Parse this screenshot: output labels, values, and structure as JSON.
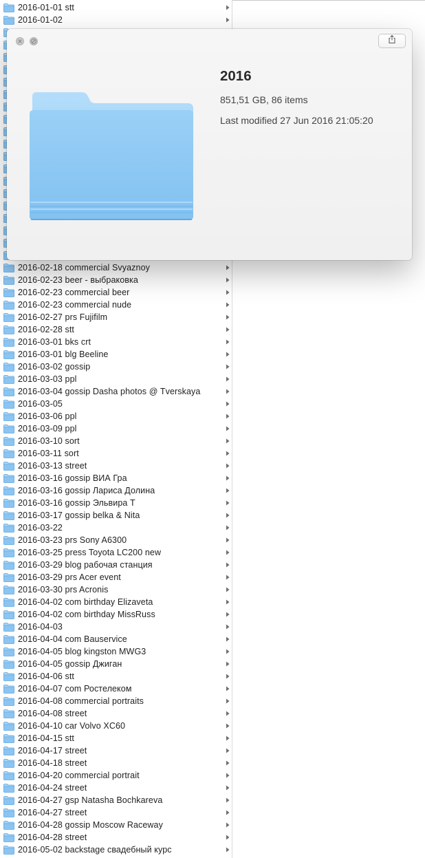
{
  "colors": {
    "folder_light": "#a9d6f7",
    "folder_body": "#8cc5f2",
    "folder_dark": "#5aa3dc",
    "text": "#222222",
    "chevron": "#6e6e6e"
  },
  "icons": {
    "row_icon": "folder-icon",
    "row_disclosure": "chevron-right-icon",
    "panel_close": "close-icon",
    "panel_fullscreen": "fullscreen-icon",
    "panel_share": "share-icon",
    "preview": "folder-icon"
  },
  "finder": {
    "items": [
      {
        "label": "2016-01-01 stt"
      },
      {
        "label": "2016-01-02"
      },
      {
        "label": ""
      },
      {
        "label": ""
      },
      {
        "label": ""
      },
      {
        "label": ""
      },
      {
        "label": ""
      },
      {
        "label": ""
      },
      {
        "label": ""
      },
      {
        "label": ""
      },
      {
        "label": ""
      },
      {
        "label": ""
      },
      {
        "label": ""
      },
      {
        "label": ""
      },
      {
        "label": ""
      },
      {
        "label": ""
      },
      {
        "label": ""
      },
      {
        "label": ""
      },
      {
        "label": ""
      },
      {
        "label": ""
      },
      {
        "label": ""
      },
      {
        "label": "2016-02-18 commercial Svyaznoy"
      },
      {
        "label": "2016-02-23 beer - выбраковка"
      },
      {
        "label": "2016-02-23 commercial beer"
      },
      {
        "label": "2016-02-23 commercial nude"
      },
      {
        "label": "2016-02-27 prs Fujifilm"
      },
      {
        "label": "2016-02-28 stt"
      },
      {
        "label": "2016-03-01 bks crt"
      },
      {
        "label": "2016-03-01 blg Beeline"
      },
      {
        "label": "2016-03-02 gossip"
      },
      {
        "label": "2016-03-03 ppl"
      },
      {
        "label": "2016-03-04 gossip Dasha photos @ Tverskaya"
      },
      {
        "label": "2016-03-05"
      },
      {
        "label": "2016-03-06 ppl"
      },
      {
        "label": "2016-03-09 ppl"
      },
      {
        "label": "2016-03-10 sort"
      },
      {
        "label": "2016-03-11 sort"
      },
      {
        "label": "2016-03-13 street"
      },
      {
        "label": "2016-03-16 gossip ВИА Гра"
      },
      {
        "label": "2016-03-16 gossip Лариса Долина"
      },
      {
        "label": "2016-03-16 gossip Эльвира Т"
      },
      {
        "label": "2016-03-17 gossip belka & Nita"
      },
      {
        "label": "2016-03-22"
      },
      {
        "label": "2016-03-23 prs Sony A6300"
      },
      {
        "label": "2016-03-25 press Toyota LC200 new"
      },
      {
        "label": "2016-03-29 blog рабочая станция"
      },
      {
        "label": "2016-03-29 prs Acer event"
      },
      {
        "label": "2016-03-30 prs Acronis"
      },
      {
        "label": "2016-04-02 com birthday Elizaveta"
      },
      {
        "label": "2016-04-02 com birthday MissRuss"
      },
      {
        "label": "2016-04-03"
      },
      {
        "label": "2016-04-04 com Bauservice"
      },
      {
        "label": "2016-04-05 blog kingston MWG3"
      },
      {
        "label": "2016-04-05 gossip Джиган"
      },
      {
        "label": "2016-04-06 stt"
      },
      {
        "label": "2016-04-07 com Ростелеком"
      },
      {
        "label": "2016-04-08 commercial portraits"
      },
      {
        "label": "2016-04-08 street"
      },
      {
        "label": "2016-04-10 car Volvo XC60"
      },
      {
        "label": "2016-04-15 stt"
      },
      {
        "label": "2016-04-17 street"
      },
      {
        "label": "2016-04-18 street"
      },
      {
        "label": "2016-04-20 commercial portrait"
      },
      {
        "label": "2016-04-24 street"
      },
      {
        "label": "2016-04-27 gsp Natasha Bochkareva"
      },
      {
        "label": "2016-04-27 street"
      },
      {
        "label": "2016-04-28 gossip Moscow Raceway"
      },
      {
        "label": "2016-04-28 street"
      },
      {
        "label": "2016-05-02 backstage свадебный курс"
      }
    ]
  },
  "quicklook": {
    "name": "2016",
    "size_line": "851,51 GB, 86 items",
    "modified_line": "Last modified 27 Jun 2016 21:05:20"
  }
}
